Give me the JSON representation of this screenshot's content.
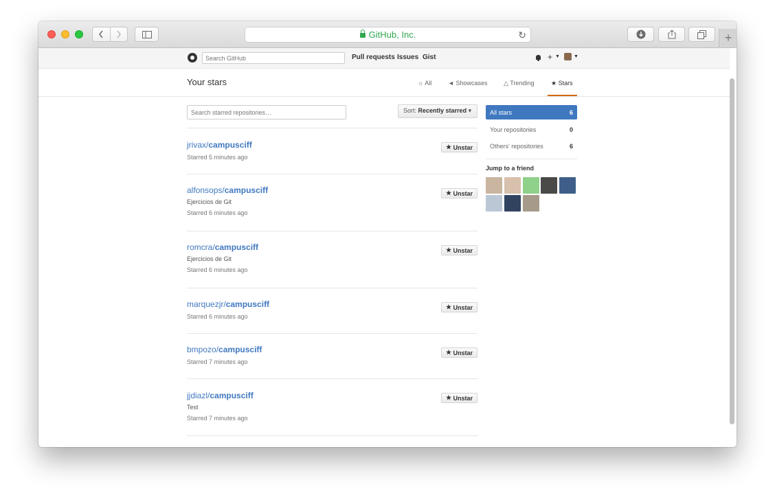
{
  "browser": {
    "address": "GitHub, Inc."
  },
  "header": {
    "search_placeholder": "Search GitHub",
    "nav": [
      "Pull requests",
      "Issues",
      "Gist"
    ],
    "plus_label": "+"
  },
  "subnav": {
    "title": "Your stars",
    "tabs": [
      {
        "icon": "explore-icon",
        "label": "All"
      },
      {
        "icon": "megaphone-icon",
        "label": "Showcases"
      },
      {
        "icon": "flame-icon",
        "label": "Trending"
      },
      {
        "icon": "star-icon",
        "label": "Stars",
        "active": true
      }
    ]
  },
  "list": {
    "search_placeholder": "Search starred repositories…",
    "sort_prefix": "Sort:",
    "sort_value": "Recently starred",
    "unstar_label": "Unstar",
    "repos": [
      {
        "owner": "jrivax",
        "separator": "/",
        "name": "campusciff",
        "desc": "",
        "time": "Starred 5 minutes ago"
      },
      {
        "owner": "alfonsops",
        "separator": "/",
        "name": "campusciff",
        "desc": "Ejercicios de Git",
        "time": "Starred 6 minutes ago"
      },
      {
        "owner": "romcra",
        "separator": "/",
        "name": "campusciff",
        "desc": "Ejercicios de Git",
        "time": "Starred 6 minutes ago"
      },
      {
        "owner": "marquezjr",
        "separator": "/",
        "name": "campusciff",
        "desc": "",
        "time": "Starred 6 minutes ago"
      },
      {
        "owner": "bmpozo",
        "separator": "/",
        "name": "campusciff",
        "desc": "",
        "time": "Starred 7 minutes ago"
      },
      {
        "owner": "jjdiazl",
        "separator": "/",
        "name": "campusciff",
        "desc": "Test",
        "time": "Starred 7 minutes ago"
      }
    ]
  },
  "sidebar": {
    "filters": [
      {
        "label": "All stars",
        "count": "6",
        "selected": true
      },
      {
        "label": "Your repositories",
        "count": "0"
      },
      {
        "label": "Others' repositories",
        "count": "6"
      }
    ],
    "friends_title": "Jump to a friend",
    "friend_colors": [
      "#c9b5a0",
      "#d7c0ac",
      "#8fd08a",
      "#4a4a48",
      "#3f5f8a",
      "#bcc7d6",
      "#31435f",
      "#a69a8a"
    ]
  }
}
